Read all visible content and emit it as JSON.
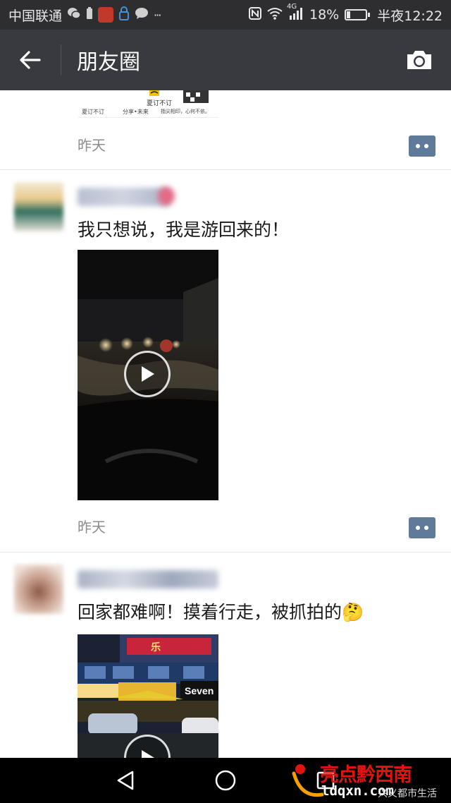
{
  "status_bar": {
    "carrier": "中国联通",
    "network": "4G",
    "battery_percent": "18%",
    "battery_level": 0.18,
    "time": "半夜12:22",
    "icons": [
      "wechat-icon",
      "battery-saver-icon",
      "huawei-icon",
      "lock-icon",
      "message-icon",
      "more-icon",
      "nfc-icon",
      "wifi-icon",
      "signal-icon",
      "battery-icon"
    ],
    "more_label": "···"
  },
  "title_bar": {
    "title": "朋友圈",
    "back_icon": "arrow-left-icon",
    "camera_icon": "camera-icon"
  },
  "feed": {
    "top_ad": {
      "line1": "夏订不订",
      "line2": "分享•未来",
      "line3": "指尖相印，心何不依。",
      "brand": "夏订不订",
      "time": "昨天"
    },
    "posts": [
      {
        "text": "我只想说，我是游回来的！",
        "time": "昨天",
        "media": "video"
      },
      {
        "text": "回家都难啊！摸着行走，被抓拍的🤔",
        "time": "",
        "media": "video",
        "shop_sign_1": "Seven",
        "shop_sign_2": "乐"
      }
    ]
  },
  "watermark": {
    "brand": "亮点黔西南",
    "url": "ldqxn.com",
    "caption": "兴义都市生活"
  },
  "colors": {
    "status_bar": "#2e2e30",
    "title_bar": "#393a3f",
    "comment_button": "#5f7b99",
    "time_text": "#8c8c8c"
  }
}
